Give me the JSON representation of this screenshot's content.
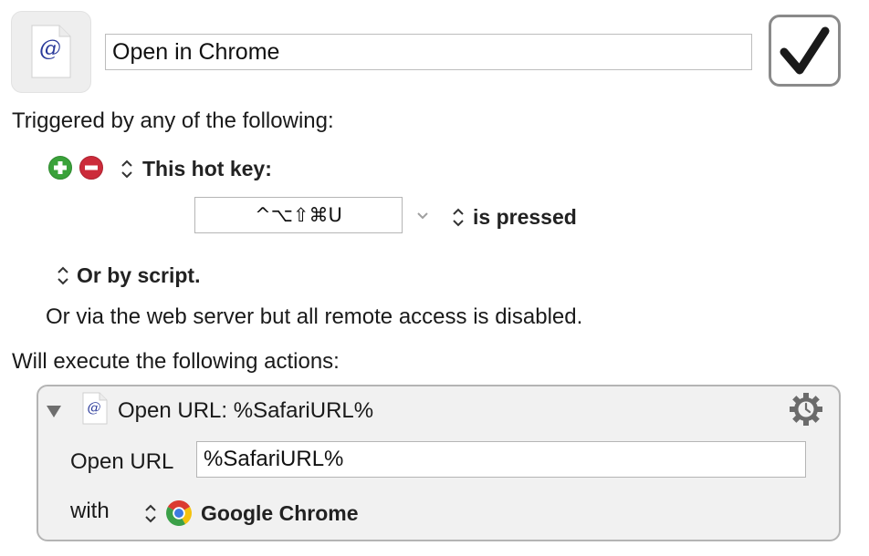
{
  "macro": {
    "name": "Open in Chrome",
    "enabled": true
  },
  "triggers": {
    "heading": "Triggered by any of the following:",
    "hotkey_label": "This hot key:",
    "hotkey_value": "^⌥⇧⌘U",
    "hotkey_condition": "is pressed",
    "script_label": "Or by script.",
    "web_server_note": "Or via the web server but all remote access is disabled."
  },
  "actions": {
    "heading": "Will execute the following actions:",
    "items": [
      {
        "title": "Open URL: %SafariURL%",
        "url_label": "Open URL",
        "url_value": "%SafariURL%",
        "with_label": "with",
        "app_name": "Google Chrome"
      }
    ]
  },
  "colors": {
    "add_green": "#3aa23a",
    "remove_red": "#cc2b3a",
    "gear_gray": "#6b6b6b"
  }
}
